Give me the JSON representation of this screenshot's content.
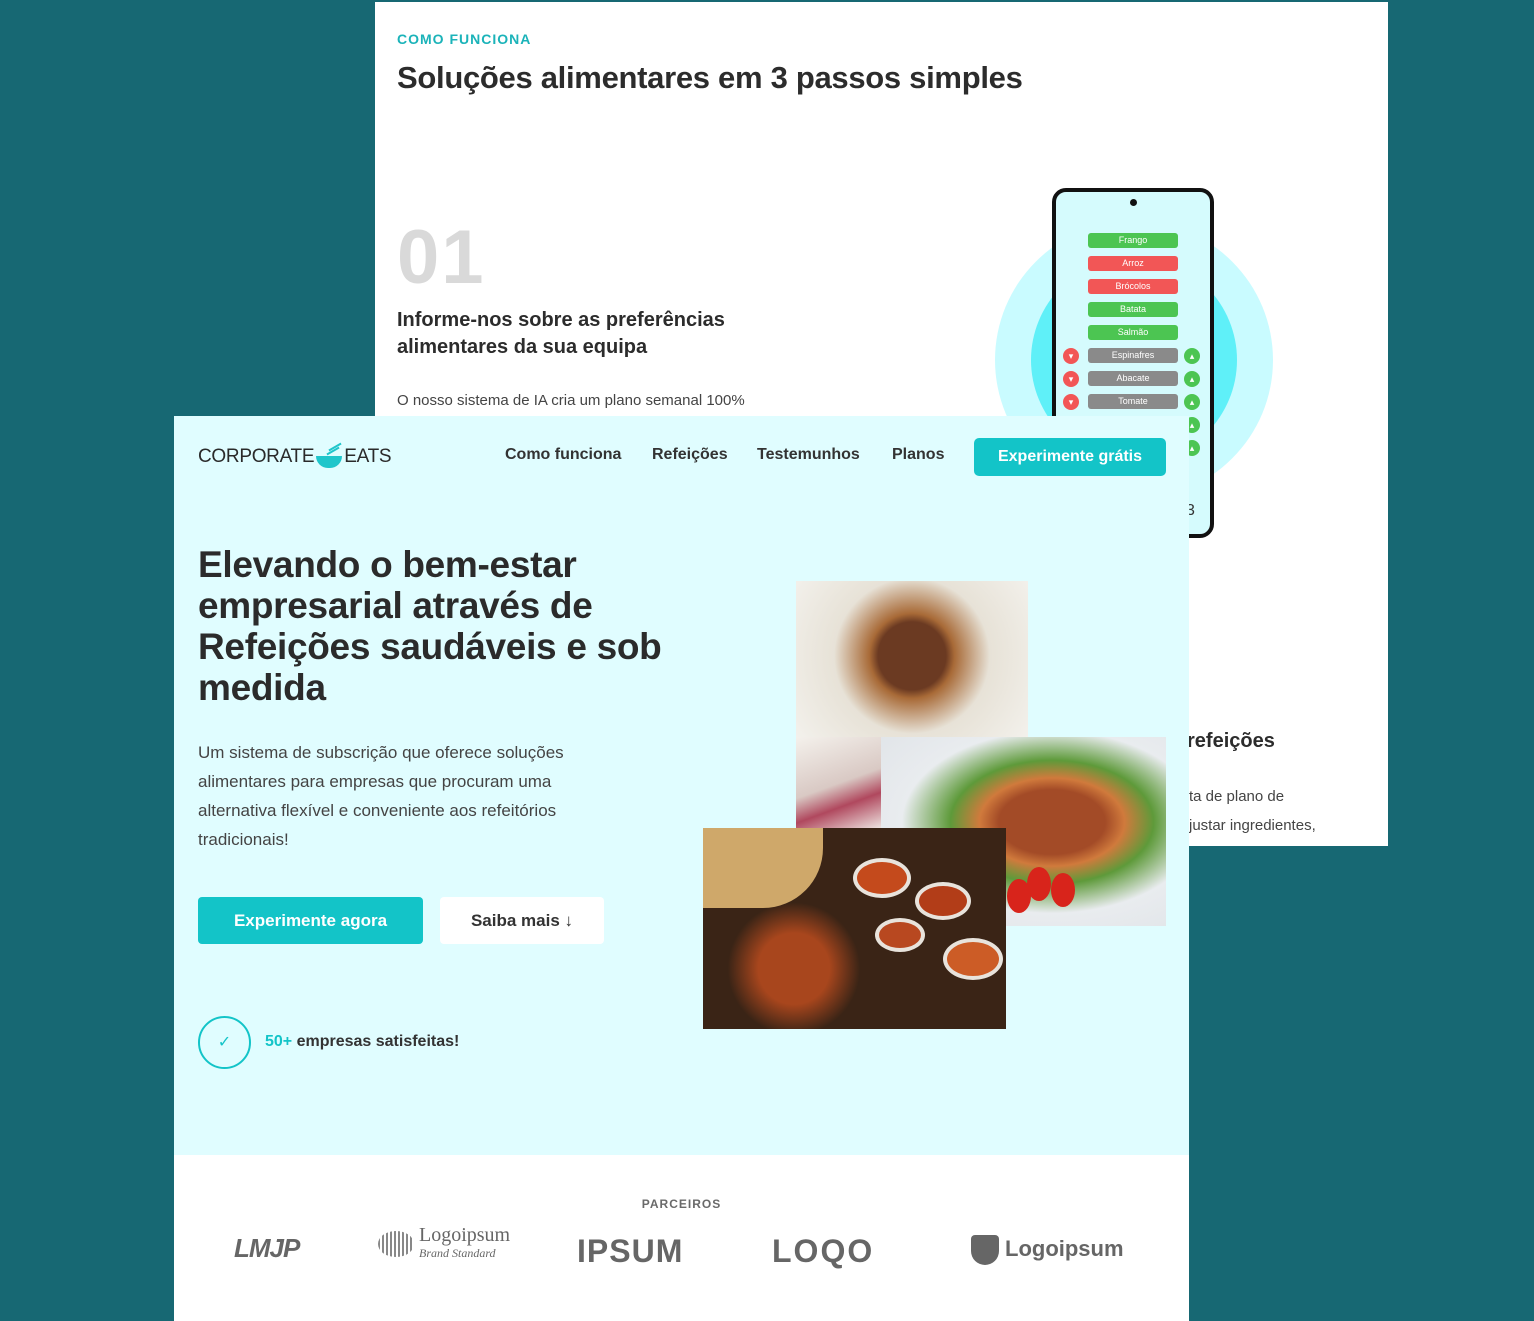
{
  "back_card": {
    "eyebrow": "COMO FUNCIONA",
    "title": "Soluções alimentares em 3 passos simples",
    "step": {
      "number": "01",
      "title": "Informe-nos sobre as preferências alimentares da sua equipa",
      "text": "O nosso sistema de IA cria um plano semanal 100%"
    },
    "step2_partial": {
      "title": "refeições",
      "text_line1": "ta de plano de",
      "text_line2": "justar ingredientes,"
    },
    "phone": {
      "items": [
        {
          "label": "Frango",
          "status": "liked"
        },
        {
          "label": "Arroz",
          "status": "disliked"
        },
        {
          "label": "Brócolos",
          "status": "disliked"
        },
        {
          "label": "Batata",
          "status": "liked"
        },
        {
          "label": "Salmão",
          "status": "liked"
        },
        {
          "label": "Espinafres",
          "status": "pending"
        },
        {
          "label": "Abacate",
          "status": "pending"
        },
        {
          "label": "Tomate",
          "status": "pending"
        }
      ],
      "corner_text": "3"
    }
  },
  "header": {
    "logo_left": "CORPORATE",
    "logo_right": "EATS",
    "nav": [
      "Como funciona",
      "Refeições",
      "Testemunhos",
      "Planos"
    ],
    "cta": "Experimente grátis"
  },
  "hero": {
    "title": "Elevando o bem-estar empresarial através de Refeições saudáveis e sob medida",
    "text": "Um sistema de subscrição que oferece soluções alimentares para empresas que procuram uma alternativa flexível e conveniente aos refeitórios tradicionais!",
    "primary_button": "Experimente agora",
    "secondary_button": "Saiba mais ↓",
    "social_number": "50+",
    "social_text": " empresas satisfeitas!"
  },
  "partners": {
    "label": "PARCEIROS",
    "logos": [
      "LMJP",
      "Logoipsum",
      "IPSUM",
      "LOQO",
      "Logoipsum"
    ],
    "logo_subtitle": "Brand Standard"
  },
  "colors": {
    "background": "#176873",
    "accent": "#13c4c8",
    "hero_bg": "#e0fdff",
    "liked": "#4cc552",
    "disliked": "#f25656"
  }
}
